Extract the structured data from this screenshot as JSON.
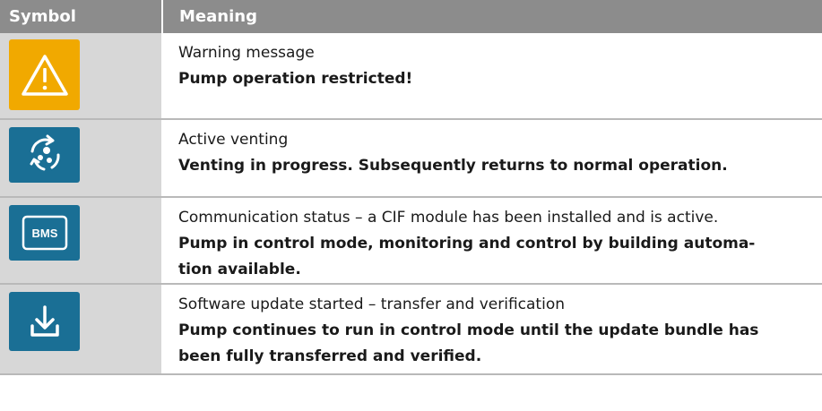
{
  "table": {
    "headers": {
      "symbol": "Symbol",
      "meaning": "Meaning"
    },
    "rows": [
      {
        "icon": "warning-triangle-icon",
        "description": "Warning message",
        "detail": "Pump operation restricted!"
      },
      {
        "icon": "venting-icon",
        "description": "Active venting",
        "detail": "Venting in progress. Subsequently returns to normal operation."
      },
      {
        "icon": "bms-icon",
        "icon_text": "BMS",
        "description": "Communication status – a CIF module has been installed and is active.",
        "detail_line1": "Pump in control mode, monitoring and control by building automa-",
        "detail_line2": "tion available."
      },
      {
        "icon": "software-download-icon",
        "description": "Software update started – transfer and verification",
        "detail_line1": "Pump continues to run in control mode until the update bundle has",
        "detail_line2": "been fully transferred and verified."
      }
    ]
  },
  "colors": {
    "header_bg": "#8c8c8c",
    "symbol_column_bg": "#d7d7d7",
    "warning_yellow": "#f1a900",
    "icon_blue": "#1a6f95"
  }
}
